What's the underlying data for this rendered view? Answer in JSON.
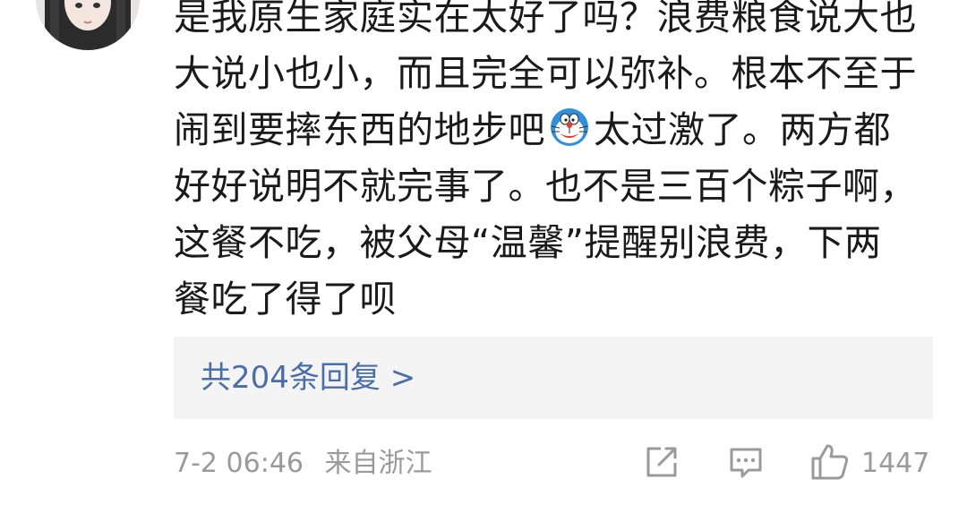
{
  "comment": {
    "lines": [
      "是我原生家庭实在太好了吗？浪费粮食说大也",
      "大说小也小，而且完全可以弥补。根本不至于",
      "闹到要摔东西的地步吧",
      "太过激了。两方都",
      "好好说明不就完事了。也不是三百个粽子啊，",
      "这餐不吃，被父母“温馨”提醒别浪费，下两",
      "餐吃了得了呗"
    ],
    "emoji": "doraemon-emoji"
  },
  "replies": {
    "label": "共204条回复 >"
  },
  "meta": {
    "time": "7-2 06:46",
    "location": "来自浙江"
  },
  "actions": {
    "like_count": "1447",
    "icons": [
      "share-icon",
      "comment-icon",
      "like-icon"
    ]
  },
  "colors": {
    "text": "#1a1a1a",
    "link": "#4a6ea8",
    "meta": "#9a9a9a",
    "replies_bg": "#f4f4f4"
  }
}
